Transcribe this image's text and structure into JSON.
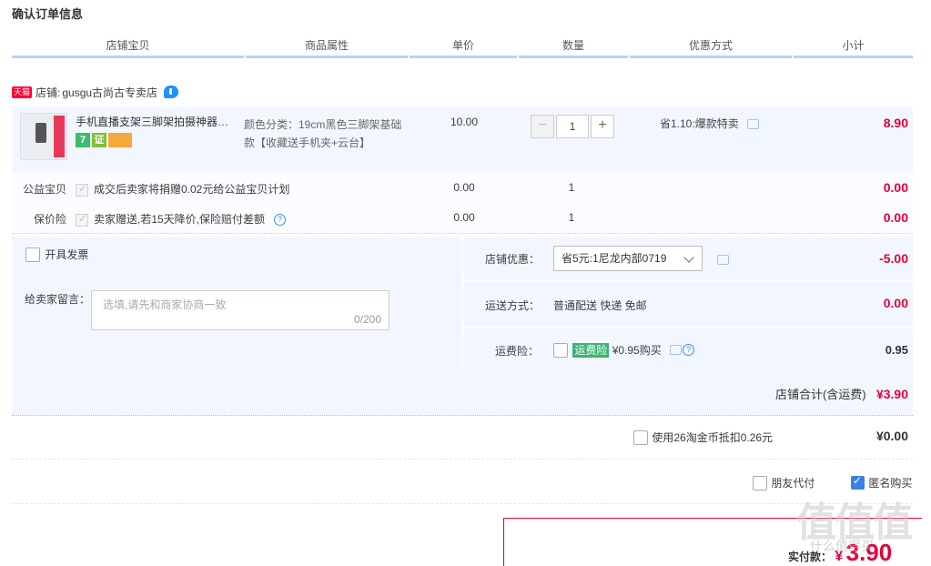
{
  "page_title": "确认订单信息",
  "columns": [
    "店铺宝贝",
    "商品属性",
    "单价",
    "数量",
    "优惠方式",
    "小计"
  ],
  "shop": {
    "badge": "天猫",
    "label": "店铺:",
    "name": "gusgu古尚古专卖店"
  },
  "item": {
    "name": "手机直播支架三脚架拍摄神器多功能",
    "sku": "颜色分类：19cm黑色三脚架基础款【收藏送手机夹+云台】",
    "badges": [
      "7",
      "证"
    ],
    "price": "10.00",
    "quantity": "1",
    "minus": "−",
    "plus": "+",
    "promo": "省1.10:爆款特卖",
    "subtotal": "8.90"
  },
  "charity": {
    "label": "公益宝贝",
    "text": "成交后卖家将捐赠0.02元给公益宝贝计划",
    "price": "0.00",
    "qty": "1",
    "subtotal": "0.00"
  },
  "price_protect": {
    "label": "保价险",
    "text": "卖家赠送,若15天降价,保险赔付差额",
    "help": "?",
    "price": "0.00",
    "qty": "1",
    "subtotal": "0.00"
  },
  "invoice": {
    "label": "开具发票"
  },
  "message": {
    "label": "给卖家留言：",
    "placeholder": "选填,请先和商家协商一致",
    "count": "0/200"
  },
  "shop_discount": {
    "label": "店铺优惠：",
    "selected": "省5元:1尼龙内部0719",
    "amount": "-5.00"
  },
  "shipping": {
    "label": "运送方式：",
    "value": "普通配送 快递 免邮",
    "amount": "0.00"
  },
  "shipping_insurance": {
    "label": "运费险：",
    "badge": "运费险",
    "text": "¥0.95购买",
    "help": "?",
    "amount": "0.95"
  },
  "shop_total": {
    "label": "店铺合计(含运费)",
    "amount": "¥3.90"
  },
  "coins": {
    "label": "使用26淘金币抵扣0.26元",
    "amount": "¥0.00"
  },
  "options": {
    "friend_pay": "朋友代付",
    "anonymous": "匿名购买"
  },
  "pay": {
    "label": "实付款：",
    "currency": "¥",
    "amount": "3.90"
  },
  "watermark": "值值值",
  "watermark_sub": "什么值得买",
  "colors": {
    "accent_red": "#e4003a",
    "header_border": "#b2d1ff",
    "panel_bg": "#f2f7ff"
  }
}
